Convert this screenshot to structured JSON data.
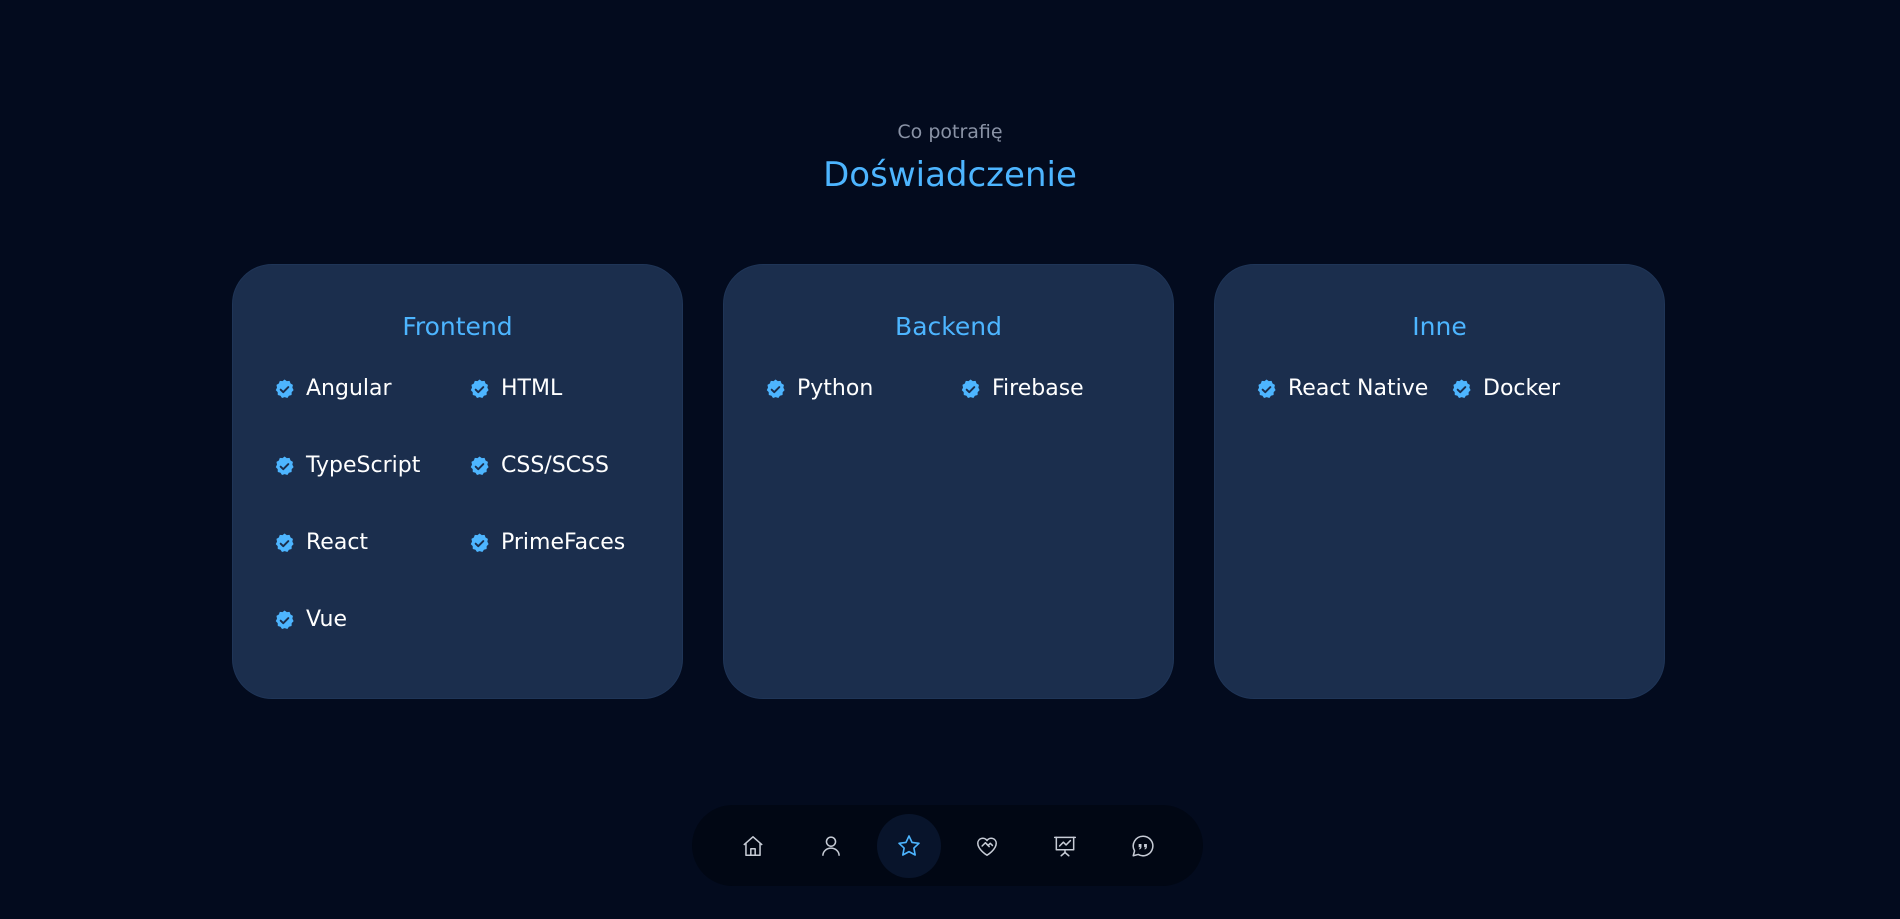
{
  "header": {
    "subtitle": "Co potrafię",
    "title": "Doświadczenie"
  },
  "colors": {
    "accent": "#4db5ff",
    "background": "#030b1e",
    "card": "#1b2e4d",
    "nav_icon": "#c7ccd6"
  },
  "cards": [
    {
      "title": "Frontend",
      "skills": [
        "Angular",
        "HTML",
        "TypeScript",
        "CSS/SCSS",
        "React",
        "PrimeFaces",
        "Vue"
      ]
    },
    {
      "title": "Backend",
      "skills": [
        "Python",
        "Firebase"
      ]
    },
    {
      "title": "Inne",
      "skills": [
        "React Native",
        "Docker"
      ]
    }
  ],
  "skill_icon": "verified-badge-icon",
  "nav": {
    "items": [
      {
        "icon": "home-icon",
        "active": false
      },
      {
        "icon": "user-icon",
        "active": false
      },
      {
        "icon": "star-icon",
        "active": true
      },
      {
        "icon": "heart-handshake-icon",
        "active": false
      },
      {
        "icon": "presentation-chart-icon",
        "active": false
      },
      {
        "icon": "quote-chat-icon",
        "active": false
      }
    ]
  }
}
